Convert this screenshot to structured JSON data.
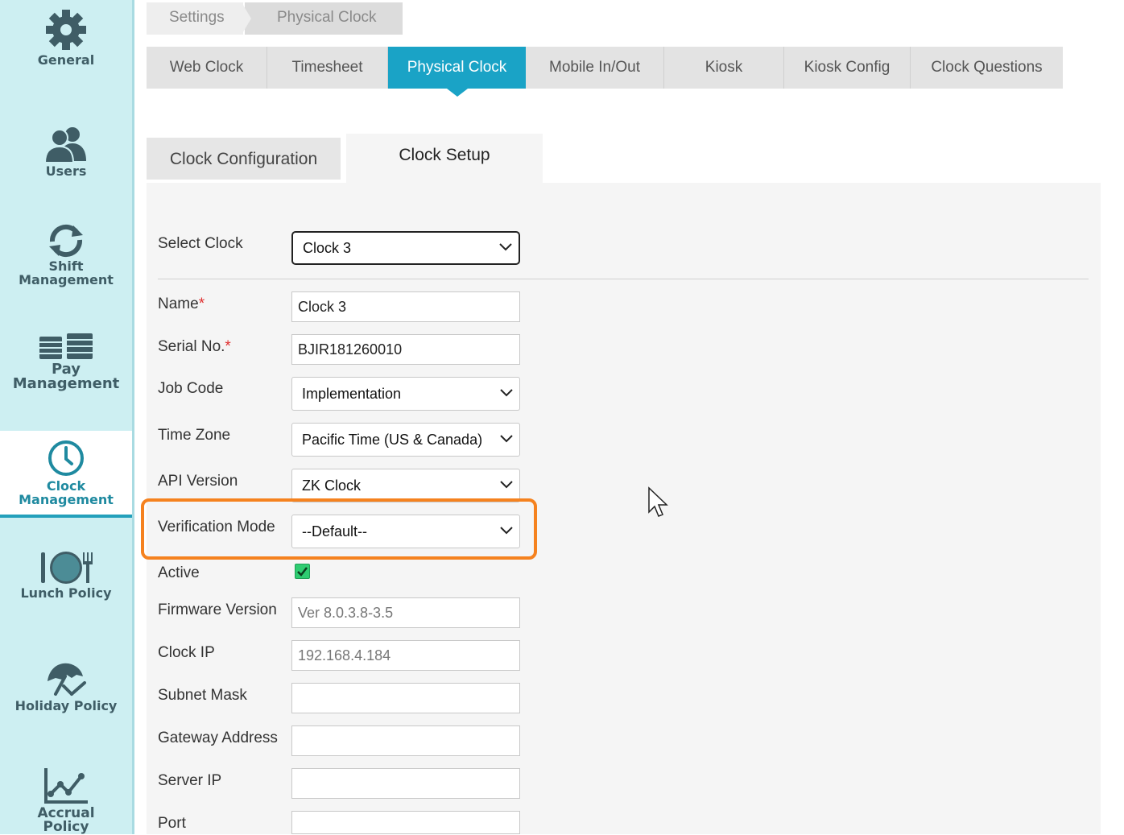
{
  "sidebar": {
    "items": [
      {
        "label": "General",
        "icon": "gear-icon"
      },
      {
        "label": "Users",
        "icon": "users-icon"
      },
      {
        "label_1": "Shift",
        "label_2": "Management",
        "icon": "refresh-icon"
      },
      {
        "label_1": "Pay",
        "label_2": "Management",
        "icon": "money-icon"
      },
      {
        "label_1": "Clock",
        "label_2": "Management",
        "icon": "clock-icon",
        "active": true
      },
      {
        "label": "Lunch Policy",
        "icon": "plate-icon"
      },
      {
        "label": "Holiday Policy",
        "icon": "umbrella-icon"
      },
      {
        "label_1": "Accrual",
        "label_2": "Policy",
        "icon": "chart-icon"
      }
    ]
  },
  "breadcrumb": {
    "items": [
      "Settings",
      "Physical Clock"
    ]
  },
  "main_tabs": {
    "items": [
      "Web Clock",
      "Timesheet",
      "Physical Clock",
      "Mobile In/Out",
      "Kiosk",
      "Kiosk Config",
      "Clock Questions"
    ],
    "active": "Physical Clock"
  },
  "sub_tabs": {
    "items": [
      "Clock Configuration",
      "Clock Setup"
    ],
    "active": "Clock Setup"
  },
  "form": {
    "select_clock": {
      "label": "Select Clock",
      "value": "Clock 3"
    },
    "name": {
      "label": "Name",
      "required": "*",
      "value": "Clock 3"
    },
    "serial": {
      "label": "Serial No.",
      "required": "*",
      "value": "BJIR181260010"
    },
    "job_code": {
      "label": "Job Code",
      "value": "Implementation"
    },
    "time_zone": {
      "label": "Time Zone",
      "value": "Pacific Time (US & Canada)"
    },
    "api_version": {
      "label": "API Version",
      "value": "ZK Clock"
    },
    "verification_mode": {
      "label": "Verification Mode",
      "value": "--Default--"
    },
    "active": {
      "label": "Active",
      "checked": true
    },
    "firmware": {
      "label": "Firmware Version",
      "value": "Ver 8.0.3.8-3.5"
    },
    "clock_ip": {
      "label": "Clock IP",
      "value": "192.168.4.184"
    },
    "subnet": {
      "label": "Subnet Mask",
      "value": ""
    },
    "gateway": {
      "label": "Gateway Address",
      "value": ""
    },
    "server_ip": {
      "label": "Server IP",
      "value": ""
    },
    "port": {
      "label": "Port",
      "value": ""
    }
  },
  "colors": {
    "sidebar_bg": "#cdeff2",
    "accent": "#1aa3c6",
    "highlight": "#f5821f",
    "check": "#2ecc71"
  }
}
